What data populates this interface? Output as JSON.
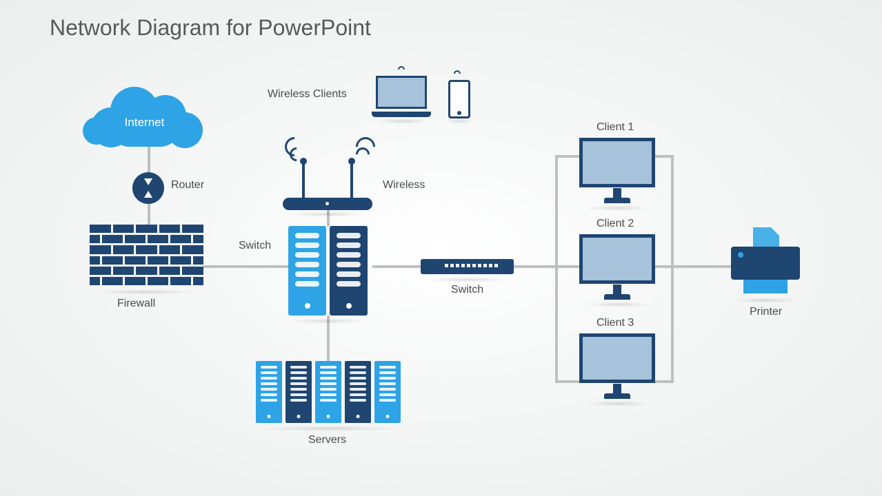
{
  "title": "Network Diagram for PowerPoint",
  "labels": {
    "internet": "Internet",
    "router": "Router",
    "firewall": "Firewall",
    "wireless": "Wireless",
    "wireless_clients": "Wireless Clients",
    "switch_top": "Switch",
    "switch_mid": "Switch",
    "servers": "Servers",
    "client1": "Client 1",
    "client2": "Client 2",
    "client3": "Client 3",
    "printer": "Printer"
  },
  "colors": {
    "dark": "#1f4571",
    "accent": "#2ea3e6",
    "line": "#bfbfbf"
  }
}
